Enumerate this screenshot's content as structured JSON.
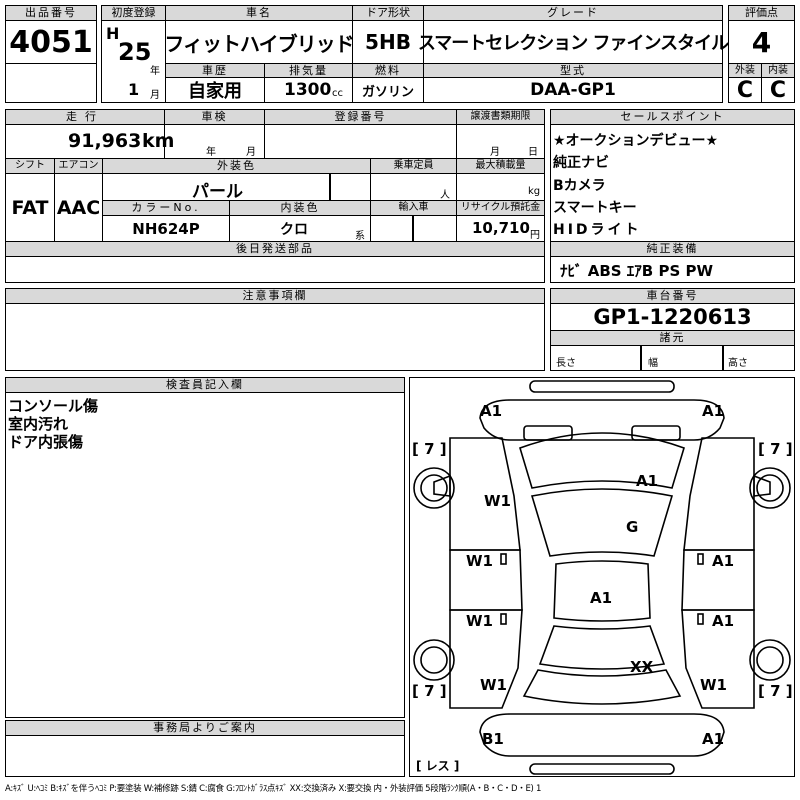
{
  "header": {
    "lot_label": "出品番号",
    "lot_no": "4051",
    "first_reg_label": "初度登録",
    "era": "H",
    "year": "25",
    "year_unit": "年",
    "month": "1",
    "month_unit": "月",
    "car_name_label": "車名",
    "car_name": "フィットハイブリッド",
    "history_label": "車歴",
    "history": "自家用",
    "displacement_label": "排気量",
    "displacement": "1300",
    "displacement_unit": "cc",
    "door_label": "ドア形状",
    "door": "5HB",
    "fuel_label": "燃料",
    "fuel": "ガソリン",
    "grade_label": "グレード",
    "grade": "スマートセレクション ファインスタイル",
    "model_label": "型式",
    "model": "DAA-GP1",
    "score_label": "評価点",
    "score": "4",
    "ext_label": "外装",
    "ext": "C",
    "int_label": "内装",
    "int": "C"
  },
  "row2": {
    "mileage_label": "走行",
    "mileage": "91,963",
    "mileage_unit": "km",
    "inspection_label": "車検",
    "insp_year_unit": "年",
    "insp_month_unit": "月",
    "reg_no_label": "登録番号",
    "transfer_label": "譲渡書類期限",
    "transfer_month_unit": "月",
    "transfer_day_unit": "日",
    "shift_label": "シフト",
    "shift": "FAT",
    "ac_label": "エアコン",
    "ac": "AAC",
    "color_label": "外装色",
    "color": "パール",
    "capacity_label": "乗車定員",
    "capacity_unit": "人",
    "load_label": "最大積載量",
    "load_unit": "kg",
    "color_no_label": "カラーNo.",
    "color_no": "NH624P",
    "interior_color_label": "内装色",
    "interior_color": "クロ",
    "interior_color_unit": "系",
    "import_label": "輸入車",
    "recycle_label": "リサイクル預託金",
    "recycle": "10,710",
    "recycle_unit": "円",
    "later_parts_label": "後日発送部品"
  },
  "sales": {
    "label": "セールスポイント",
    "items": [
      "★オークションデビュー★",
      "純正ナビ",
      "Bカメラ",
      "スマートキー",
      "HIDライト"
    ]
  },
  "equipment": {
    "label": "純正装備",
    "value": "ﾅﾋﾞ ABS ｴｱB PS PW"
  },
  "notes": {
    "label": "注意事項欄"
  },
  "chassis": {
    "label": "車台番号",
    "value": "GP1-1220613"
  },
  "specs": {
    "label": "諸元",
    "length_label": "長さ",
    "width_label": "幅",
    "height_label": "高さ"
  },
  "inspector": {
    "label": "検査員記入欄",
    "lines": [
      "コンソール傷",
      "室内汚れ",
      "ドア内張傷"
    ]
  },
  "office": {
    "label": "事務局よりご案内"
  },
  "diagram": {
    "marks": {
      "front_left": "A1",
      "front_right": "A1",
      "hood": "A1",
      "windshield": "G",
      "roof": "A1",
      "trunk": "XX",
      "left_fender": "W1",
      "left_front_door": "W1",
      "left_rear_door": "W1",
      "left_quarter": "W1",
      "right_front_door": "A1",
      "right_rear_door": "A1",
      "right_quarter": "W1",
      "rear_left": "B1",
      "rear_right": "A1",
      "tire_fl": "[ 7 ]",
      "tire_fr": "[ 7 ]",
      "tire_rl": "[ 7 ]",
      "tire_rr": "[ 7 ]",
      "spare": "[ レス ]"
    }
  },
  "legend": "A:ｷｽﾞ U:ﾍｺﾐ B:ｷｽﾞを伴うﾍｺﾐ P:要塗装 W:補修跡 S:錆 C:腐食 G:ﾌﾛﾝﾄｶﾞﾗｽ点ｷｽﾞ XX:交換済み X:要交換 内・外装評価 5段階ﾗﾝｸ順(A・B・C・D・E) 1"
}
